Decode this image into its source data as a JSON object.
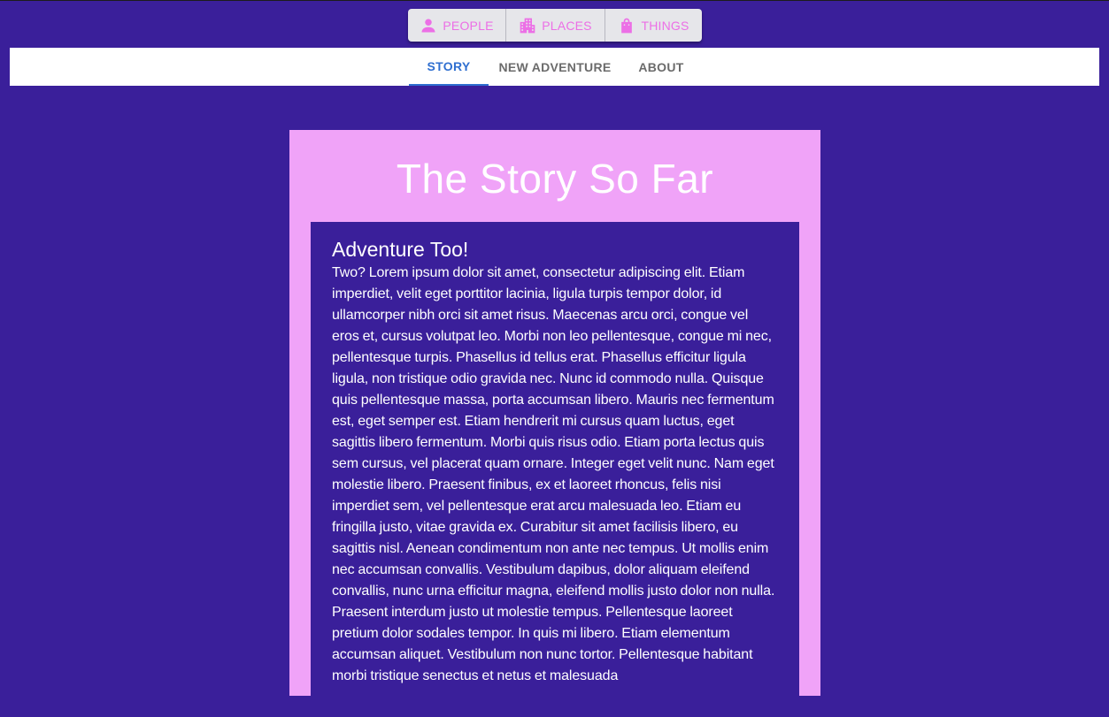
{
  "toolbar": {
    "people": {
      "label": "PEOPLE",
      "icon": "person-icon"
    },
    "places": {
      "label": "PLACES",
      "icon": "buildings-icon"
    },
    "things": {
      "label": "THINGS",
      "icon": "shopping-bag-icon"
    }
  },
  "tabs": [
    {
      "label": "STORY",
      "active": true
    },
    {
      "label": "NEW ADVENTURE",
      "active": false
    },
    {
      "label": "ABOUT",
      "active": false
    }
  ],
  "story": {
    "title": "The Story So Far",
    "adventure": {
      "heading": "Adventure Too!",
      "body": "Two? Lorem ipsum dolor sit amet, consectetur adipiscing elit. Etiam imperdiet, velit eget porttitor lacinia, ligula turpis tempor dolor, id ullamcorper nibh orci sit amet risus. Maecenas arcu orci, congue vel eros et, cursus volutpat leo. Morbi non leo pellentesque, congue mi nec, pellentesque turpis. Phasellus id tellus erat. Phasellus efficitur ligula ligula, non tristique odio gravida nec. Nunc id commodo nulla. Quisque quis pellentesque massa, porta accumsan libero. Mauris nec fermentum est, eget semper est. Etiam hendrerit mi cursus quam luctus, eget sagittis libero fermentum. Morbi quis risus odio. Etiam porta lectus quis sem cursus, vel placerat quam ornare. Integer eget velit nunc. Nam eget molestie libero. Praesent finibus, ex et laoreet rhoncus, felis nisi imperdiet sem, vel pellentesque erat arcu malesuada leo. Etiam eu fringilla justo, vitae gravida ex. Curabitur sit amet facilisis libero, eu sagittis nisl. Aenean condimentum non ante nec tempus. Ut mollis enim nec accumsan convallis. Vestibulum dapibus, dolor aliquam eleifend convallis, nunc urna efficitur magna, eleifend mollis justo dolor non nulla. Praesent interdum justo ut molestie tempus. Pellentesque laoreet pretium dolor sodales tempor. In quis mi libero. Etiam elementum accumsan aliquet. Vestibulum non nunc tortor. Pellentesque habitant morbi tristique senectus et netus et malesuada"
    }
  },
  "colors": {
    "background": "#3a1f9a",
    "card": "#f0a3f8",
    "accent_pink": "#ec6fe6",
    "tab_active": "#2f6fd0"
  }
}
